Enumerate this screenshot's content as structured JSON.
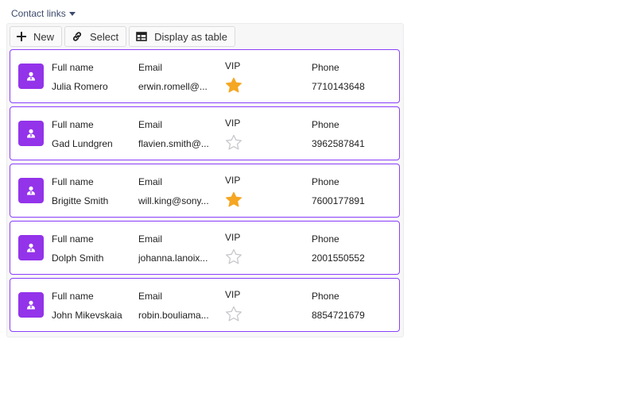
{
  "section": {
    "title": "Contact links"
  },
  "toolbar": {
    "new_label": "New",
    "select_label": "Select",
    "display_label": "Display as table"
  },
  "columns": {
    "name": "Full name",
    "email": "Email",
    "vip": "VIP",
    "phone": "Phone"
  },
  "colors": {
    "accent": "#8a3ffc",
    "avatar": "#9333ea",
    "star_on": "#f5a623",
    "star_off": "#c8c8cc"
  },
  "contacts": [
    {
      "name": "Julia Romero",
      "email": "erwin.romell@...",
      "vip": true,
      "phone": "7710143648"
    },
    {
      "name": "Gad Lundgren",
      "email": "flavien.smith@...",
      "vip": false,
      "phone": "3962587841"
    },
    {
      "name": "Brigitte Smith",
      "email": "will.king@sony...",
      "vip": true,
      "phone": "7600177891"
    },
    {
      "name": "Dolph Smith",
      "email": "johanna.lanoix...",
      "vip": false,
      "phone": "2001550552"
    },
    {
      "name": "John Mikevskaia",
      "email": "robin.bouliama...",
      "vip": false,
      "phone": "8854721679"
    }
  ]
}
